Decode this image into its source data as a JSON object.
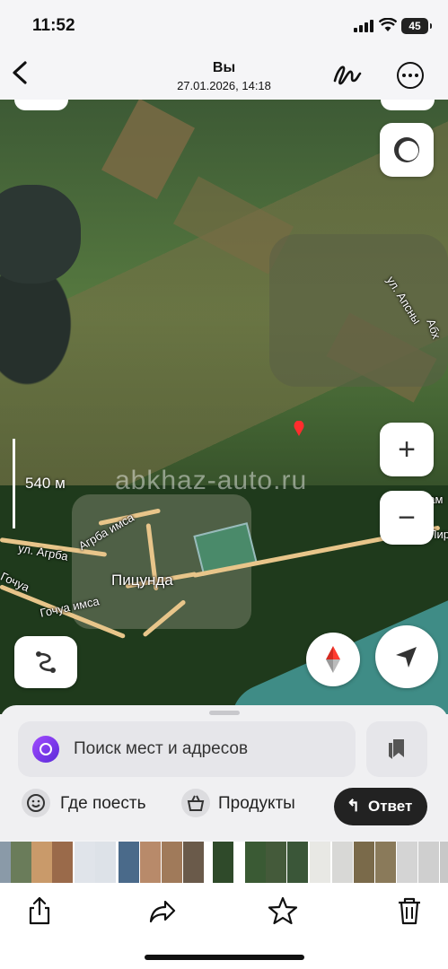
{
  "status_bar": {
    "time": "11:52",
    "battery": "45"
  },
  "header": {
    "title": "Вы",
    "subtitle": "27.01.2026, 14:18"
  },
  "map": {
    "scale_label": "540 м",
    "watermark": "abkhaz-auto.ru",
    "town_label": "Пицунда",
    "street_labels": [
      "ул. Апсны",
      "Абх",
      "ул. Адам",
      "Лир",
      "ул. Агрба",
      "Агрба имса",
      "Гочуа",
      "Гочуа имса"
    ],
    "pin_color": "#ff2d2d",
    "buttons": {
      "zoom_in": "+",
      "zoom_out": "−"
    }
  },
  "sheet": {
    "search_placeholder": "Поиск мест и адресов",
    "chips": [
      "Где поесть",
      "Продукты"
    ],
    "reply_label": "Ответ"
  },
  "toolbar": {
    "icons": [
      "share-icon",
      "forward-icon",
      "star-icon",
      "trash-icon"
    ]
  },
  "colors": {
    "accent": "#6a35e0",
    "reply_bg": "#222222"
  }
}
